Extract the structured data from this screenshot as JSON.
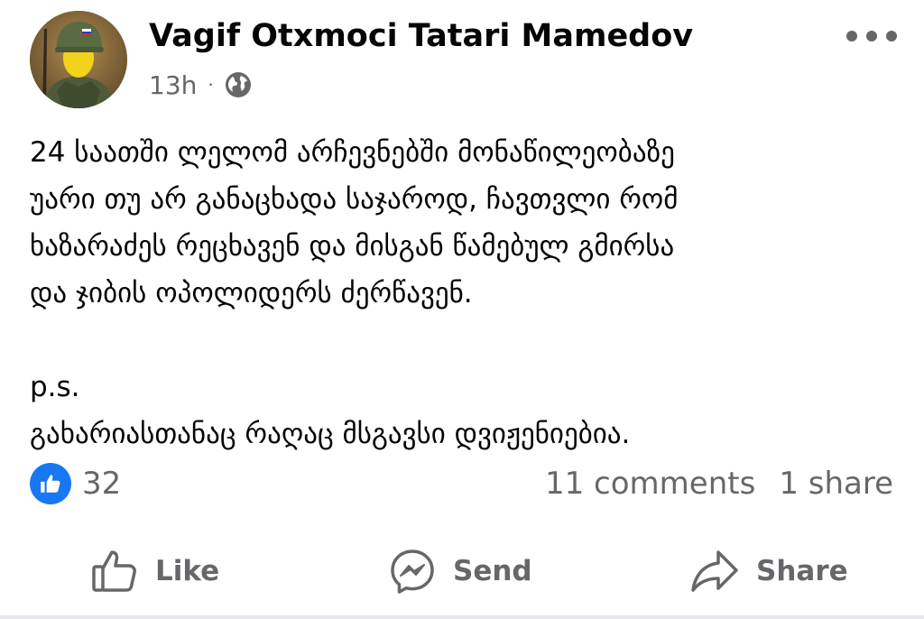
{
  "post": {
    "author": "Vagif Otxmoci Tatari Mamedov",
    "time": "13h",
    "separator": "·",
    "audience_icon": "globe-icon",
    "more_icon": "more-options-icon",
    "body_lines": [
      "24 საათში ლელომ არჩევნებში მონაწილეობაზე",
      "უარი თუ არ განაცხადა საჯაროდ, ჩავთვლი რომ",
      "ხაზარაძეს რეცხავენ და მისგან წამებულ გმირსა",
      "და ჯიბის ოპოლიდერს ძერწავენ."
    ],
    "ps_label": "p.s.",
    "ps_text": "გახარიასთანაც რაღაც მსგავსი დვიჟენიებია."
  },
  "engagement": {
    "reaction_icon": "like-reaction-icon",
    "reaction_count": "32",
    "comments": "11 comments",
    "shares": "1 share"
  },
  "actions": {
    "like_label": "Like",
    "send_label": "Send",
    "share_label": "Share"
  },
  "colors": {
    "text": "#050505",
    "secondary": "#65676b",
    "accent": "#1877f2"
  }
}
